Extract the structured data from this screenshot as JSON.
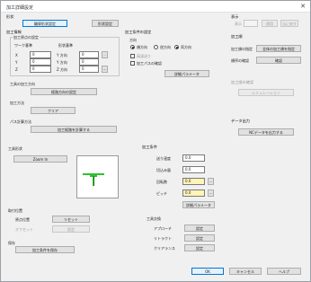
{
  "window": {
    "title": "加工詳細設定",
    "close_icon": "close-icon"
  },
  "left": {
    "group_title": "形状",
    "primary_button": "輪郭形状設定",
    "side_button": "形状設定",
    "section_title": "加工情報",
    "sub_a": "加工原点の設定",
    "sub_a_col1": "ワーク基準",
    "sub_a_col2": "形状基準",
    "row1_label": "X",
    "row1_value": "0",
    "row1_label2": "Y 方向",
    "row1_value2": "0",
    "row2_label": "Y",
    "row2_value": "0",
    "row2_label2": "Y 方向",
    "row2_value2": "0",
    "row3_label": "Z",
    "row3_value": "0",
    "row3_label2": "Z 方向",
    "row3_value2": "0",
    "tool_heading": "工具の加工方向",
    "tool_button": "経路方向の設定",
    "mid_heading": "加工方法",
    "mid_button": "クリア",
    "path_heading": "パス計算方法",
    "path_button": "加工経路を計算する",
    "preview_heading": "工具形状",
    "preview_button": "Zoom In",
    "bottom_heading": "取付位置",
    "bottom_row1_label": "原点位置",
    "bottom_row1_button": "リセット",
    "bottom_row2_label": "オフセット",
    "bottom_row2_button": "設定",
    "sub_heading": "保存",
    "sub_button": "加工条件を保存"
  },
  "middle": {
    "heading": "加工条件の設定",
    "sub_heading": "方向",
    "radio1": "順方向",
    "radio2": "逆方向",
    "radio3": "両方向",
    "chk1": "高速送り",
    "chk2": "加工パスの確認",
    "detail_button": "詳細パラメータ",
    "params_heading": "加工条件",
    "p1_label": "送り速度",
    "p1_value": "0.0",
    "p2_label": "切込み量",
    "p2_value": "0.0",
    "p3_label": "回転数",
    "p3_value": "0.0",
    "p4_label": "ピッチ",
    "p4_value": "0.0",
    "p_button": "詳細パラメータ",
    "bottom_heading": "工具交換",
    "b1_label": "アプローチ",
    "b1_button": "設定",
    "b2_label": "リトラクト",
    "b2_button": "設定",
    "b3_label": "クリアランス",
    "b3_button": "設定"
  },
  "right": {
    "header_title": "表示",
    "header_dim": "表示",
    "header_btn1": "適用",
    "header_btn2": "元に戻す",
    "group1_title": "加工順",
    "g1_label1": "加工順の指定",
    "g1_button1": "全体の加工順を指定",
    "g1_label2": "順序の確認",
    "g1_button2": "確認",
    "group2_title": "加工順の確認",
    "g2_button": "シミュレーション",
    "group3_title": "データ出力",
    "g3_button": "NCデータを出力する",
    "ok": "OK",
    "cancel": "キャンセル",
    "help": "ヘルプ"
  },
  "colors": {
    "accent": "#0078d7",
    "highlight_field": "#fff4b8"
  }
}
